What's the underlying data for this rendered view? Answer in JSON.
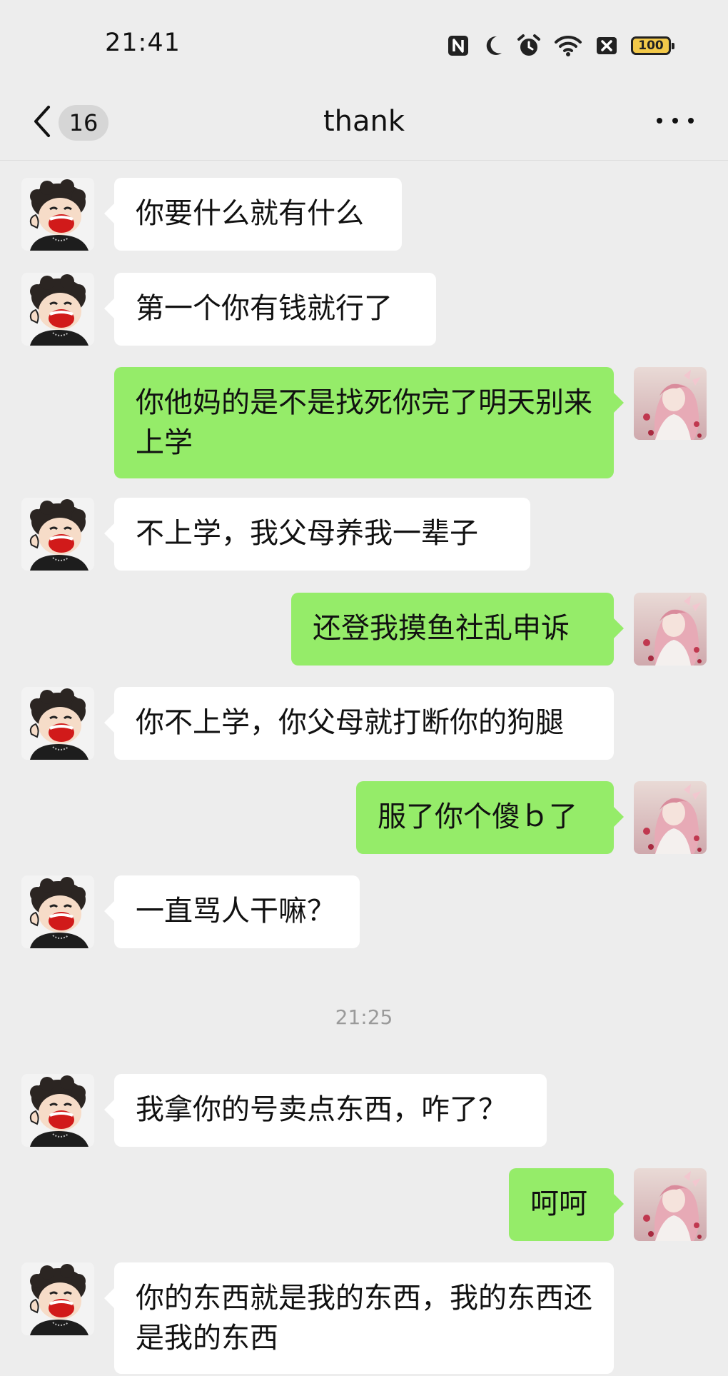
{
  "status_bar": {
    "time": "21:41",
    "battery": "100",
    "icons": [
      "nfc-icon",
      "moon-icon",
      "alarm-icon",
      "wifi-icon",
      "sim-off-icon",
      "battery-icon"
    ]
  },
  "header": {
    "back_label": "<",
    "unread_count": "16",
    "title": "thank",
    "more_label": "more"
  },
  "colors": {
    "background": "#ededed",
    "sent_bubble": "#95ec69",
    "received_bubble": "#ffffff"
  },
  "messages": [
    {
      "side": "left",
      "text": "你要什么就有什么"
    },
    {
      "side": "left",
      "text": "第一个你有钱就行了"
    },
    {
      "side": "right",
      "text": "你他妈的是不是找死你完了明天别来上学"
    },
    {
      "side": "left",
      "text": "不上学，我父母养我一辈子"
    },
    {
      "side": "right",
      "text": "还登我摸鱼社乱申诉"
    },
    {
      "side": "left",
      "text": "你不上学，你父母就打断你的狗腿"
    },
    {
      "side": "right",
      "text": "服了你个傻ｂ了"
    },
    {
      "side": "left",
      "text": "一直骂人干嘛？"
    },
    {
      "side": "left",
      "text": "我拿你的号卖点东西，咋了？"
    },
    {
      "side": "right",
      "text": "呵呵"
    },
    {
      "side": "left",
      "text": "你的东西就是我的东西，我的东西还是我的东西"
    }
  ],
  "timestamp": "21:25"
}
